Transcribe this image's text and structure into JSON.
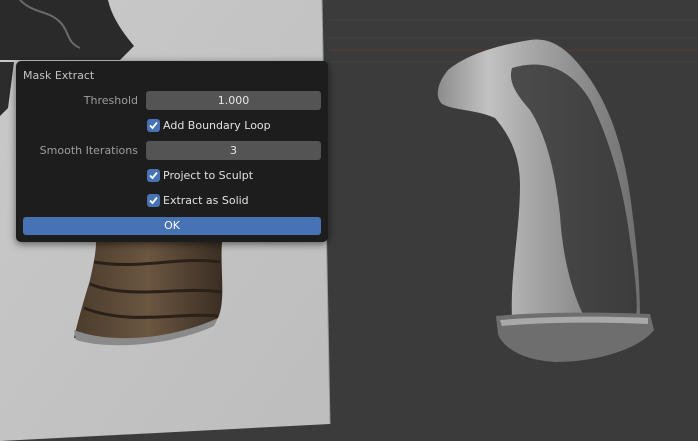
{
  "panel": {
    "title": "Mask Extract",
    "threshold": {
      "label": "Threshold",
      "value": "1.000"
    },
    "add_boundary_loop": {
      "label": "Add Boundary Loop",
      "checked": true
    },
    "smooth_iterations": {
      "label": "Smooth Iterations",
      "value": "3"
    },
    "project_to_sculpt": {
      "label": "Project to Sculpt",
      "checked": true
    },
    "extract_as_solid": {
      "label": "Extract as Solid",
      "checked": true
    },
    "ok_label": "OK"
  },
  "colors": {
    "accent": "#4772b3",
    "panel_bg": "#1d1d1d",
    "viewport_bg": "#3a3a3a",
    "field_bg": "#545454"
  },
  "icons": [
    "checkmark-icon"
  ]
}
